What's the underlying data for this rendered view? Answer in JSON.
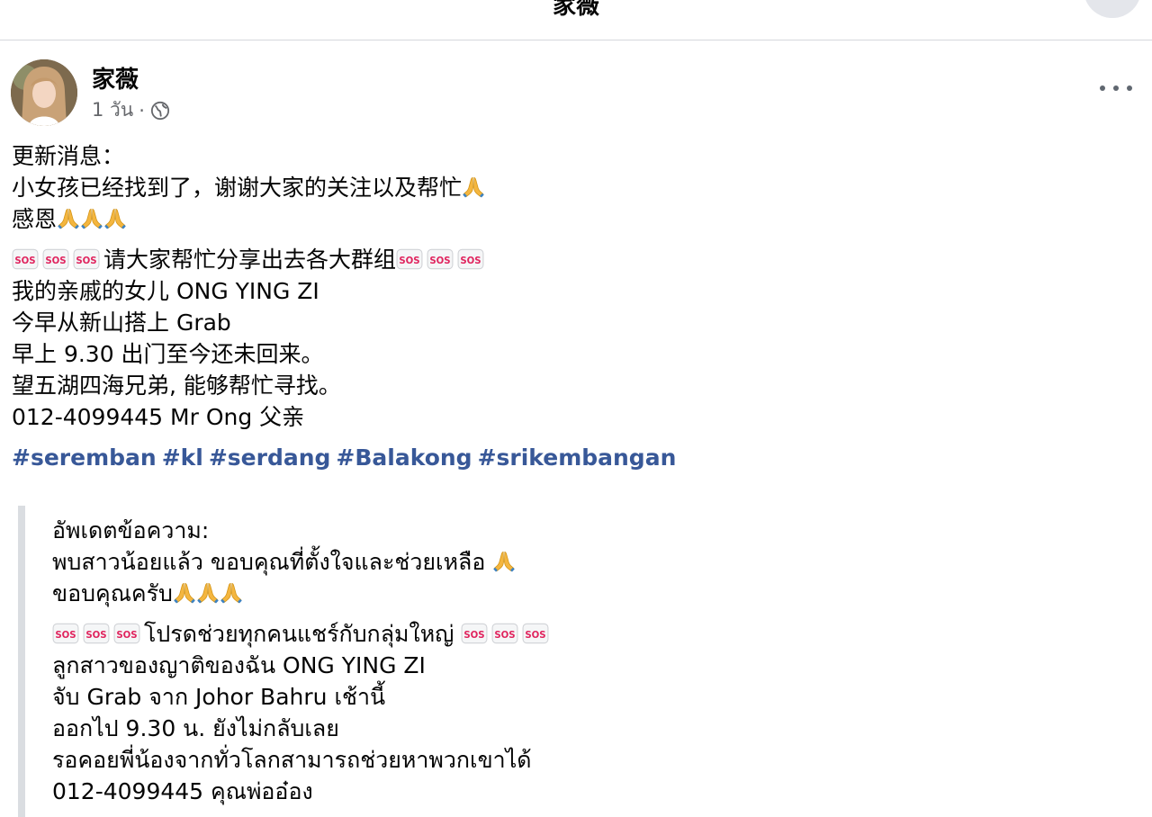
{
  "topbar": {
    "title": "家薇"
  },
  "post": {
    "author": "家薇",
    "timestamp": "1 วัน",
    "separator": "·",
    "audience_icon": "globe-icon",
    "more_icon": "more-icon",
    "update_label": "更新消息：",
    "update_line": "小女孩已经找到了，谢谢大家的关注以及帮忙",
    "thanks": "感恩",
    "share_request": "请大家帮忙分享出去各大群组",
    "body_lines": [
      "我的亲戚的女儿 ONG YING ZI",
      "今早从新山搭上 Grab",
      "早上 9.30 出门至今还未回来。",
      "望五湖四海兄弟, 能够帮忙寻找。",
      "012-4099445 Mr Ong 父亲"
    ],
    "hashtags": [
      "#seremban",
      "#kl",
      "#serdang",
      "#Balakong",
      "#srikembangan"
    ]
  },
  "translation": {
    "update_label": "อัพเดตข้อความ:",
    "update_line": "พบสาวน้อยแล้ว ขอบคุณที่ตั้งใจและช่วยเหลือ",
    "thanks": "ขอบคุณครับ",
    "share_request": "โปรดช่วยทุกคนแชร์กับกลุ่มใหญ่",
    "body_lines": [
      "ลูกสาวของญาติของฉัน ONG YING ZI",
      "จับ Grab จาก Johor Bahru เช้านี้",
      "ออกไป 9.30 น. ยังไม่กลับเลย",
      "รอคอยพี่น้องจากทั่วโลกสามารถช่วยหาพวกเขาได้",
      "012-4099445 คุณพ่ออ๋อง"
    ]
  },
  "emoji": {
    "sos_label": "SOS",
    "sos_color": "#e0245e",
    "pray_color": "#f4b63f"
  },
  "colors": {
    "hashtag": "#385898",
    "meta": "#65676b",
    "quote_bar": "#dadde1"
  }
}
